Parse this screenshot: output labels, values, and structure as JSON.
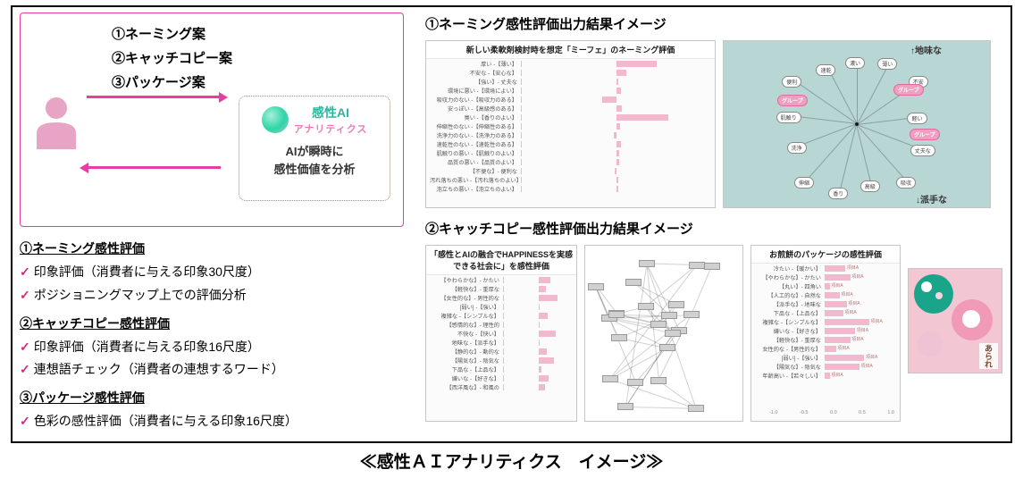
{
  "caption": "≪感性ＡＩアナリティクス　イメージ≫",
  "left": {
    "inputs": [
      "①ネーミング案",
      "②キャッチコピー案",
      "③パッケージ案"
    ],
    "ai": {
      "brand_main": "感性AI",
      "brand_sub": "アナリティクス",
      "desc_l1": "AIが瞬時に",
      "desc_l2": "感性価値を分析"
    },
    "detail": [
      {
        "hd": "①ネーミング感性評価",
        "pts": [
          "印象評価（消費者に与える印象30尺度）",
          "ポジショニングマップ上での評価分析"
        ]
      },
      {
        "hd": "②キャッチコピー感性評価",
        "pts": [
          "印象評価（消費者に与える印象16尺度）",
          "連想語チェック（消費者の連想するワード）"
        ]
      },
      {
        "hd": "③パッケージ感性評価",
        "pts": [
          "色彩の感性評価（消費者に与える印象16尺度）"
        ]
      }
    ]
  },
  "right": {
    "sec1": "①ネーミング感性評価出力結果イメージ",
    "sec2": "②キャッチコピー感性評価出力結果イメージ",
    "chart1": {
      "title": "新しい柔軟剤検討時を想定「ミーフェ」のネーミング評価",
      "rows": [
        {
          "label": "厚い -【薄い】",
          "v": 0.42
        },
        {
          "label": "不安な -【安心な】",
          "v": 0.1
        },
        {
          "label": "【強い】- 丈夫な",
          "v": 0.02
        },
        {
          "label": "環境に悪い -【環境によい】",
          "v": 0.05
        },
        {
          "label": "吸収力のない -【吸収力のある】",
          "v": -0.15
        },
        {
          "label": "安っぽい -【高級感のある】",
          "v": 0.06
        },
        {
          "label": "臭い -【香りのよい】",
          "v": 0.55
        },
        {
          "label": "伸縮性のない -【伸縮性のある】",
          "v": 0.04
        },
        {
          "label": "洗浄力のない -【洗浄力のある】",
          "v": -0.03
        },
        {
          "label": "速乾性のない -【速乾性のある】",
          "v": 0.05
        },
        {
          "label": "肌触りの悪い -【肌触りのよい】",
          "v": 0.03
        },
        {
          "label": "品質の悪い -【品質のよい】",
          "v": 0.03
        },
        {
          "label": "【不便な】- 便利な",
          "v": -0.02
        },
        {
          "label": "汚れ落ちの悪い -【汚れ落ちのよい】",
          "v": 0.02
        },
        {
          "label": "泡立ちの悪い -【泡立ちのよい】",
          "v": 0.02
        }
      ]
    },
    "map1": {
      "note_top": "↑地味な",
      "note_bottom": "↓派手な",
      "words": [
        "濃い",
        "薄い",
        "不安",
        "軽い",
        "丈夫な",
        "吸収",
        "高級",
        "香り",
        "伸縮",
        "洗浄",
        "肌触り",
        "便利",
        "速乾"
      ],
      "groups": [
        "グループ",
        "グループ",
        "グループ"
      ]
    },
    "chart2a": {
      "title": "「感性とAIの融合でHAPPINESSを実感できる社会に」を感性評価",
      "rows": [
        {
          "label": "【やわらかな】- かたい",
          "v": 0.35
        },
        {
          "label": "【軽快な】- 重厚な",
          "v": 0.22
        },
        {
          "label": "【女性的な】- 男性的な",
          "v": 0.55
        },
        {
          "label": "[弱い] -【強い】",
          "v": 0.05
        },
        {
          "label": "複雑な -【シンプルな】",
          "v": 0.28
        },
        {
          "label": "【感情的な】- 理性的",
          "v": 0.05
        },
        {
          "label": "不快な -【快い】",
          "v": 0.5
        },
        {
          "label": "地味な -【派手な】",
          "v": 0.05
        },
        {
          "label": "【静的な】- 動的な",
          "v": 0.24
        },
        {
          "label": "【陽気な】- 陰気な",
          "v": 0.45
        },
        {
          "label": "下品な -【上品な】",
          "v": 0.08
        },
        {
          "label": "嫌いな -【好きな】",
          "v": 0.3
        },
        {
          "label": "【西洋風な】- 和風の",
          "v": 0.2
        }
      ]
    },
    "chart2b": {
      "title": "お煎餅のパッケージの感性評価",
      "rows": [
        {
          "label": "冷たい -【暖かい】",
          "v": 0.28
        },
        {
          "label": "【やわらかな】- かたい",
          "v": 0.35
        },
        {
          "label": "【丸い】- 四角い",
          "v": 0.06
        },
        {
          "label": "【人工的な】- 自然な",
          "v": 0.2
        },
        {
          "label": "【派手な】- 地味な",
          "v": 0.3
        },
        {
          "label": "下品な -【上品な】",
          "v": 0.25
        },
        {
          "label": "複雑な -【シンプルな】",
          "v": 0.62
        },
        {
          "label": "嫌いな -【好きな】",
          "v": 0.42
        },
        {
          "label": "【軽快な】- 重厚な",
          "v": 0.35
        },
        {
          "label": "女性的な -【男性的な】",
          "v": 0.15
        },
        {
          "label": "[弱い] -【強い】",
          "v": 0.55
        },
        {
          "label": "【陽気な】- 陰気な",
          "v": 0.48
        },
        {
          "label": "年齢高い -【若々しい】",
          "v": 0.06
        }
      ]
    },
    "pkg_label": "あられ",
    "legend_tag": "項目A"
  }
}
